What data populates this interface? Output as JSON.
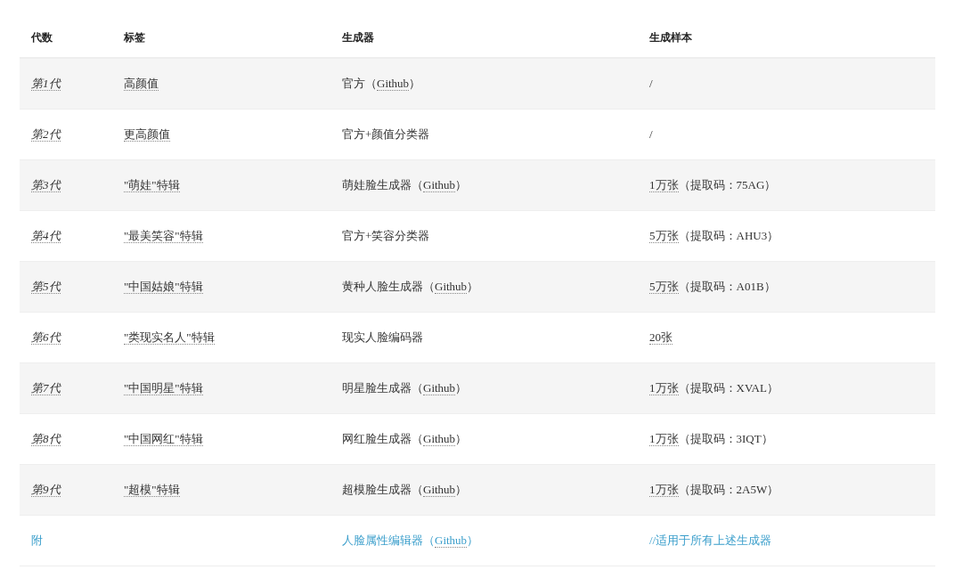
{
  "table": {
    "columns": [
      "代数",
      "标签",
      "生成器",
      "生成样本"
    ],
    "rows": [
      {
        "kind": "normal",
        "cells": [
          [
            {
              "text": "第1代",
              "link": true
            }
          ],
          [
            {
              "text": "高颜值",
              "link": true
            }
          ],
          [
            {
              "text": "官方（",
              "link": false
            },
            {
              "text": "Github",
              "link": true
            },
            {
              "text": "）",
              "link": false
            }
          ],
          [
            {
              "text": "/",
              "link": false
            }
          ]
        ]
      },
      {
        "kind": "normal",
        "cells": [
          [
            {
              "text": "第2代",
              "link": true
            }
          ],
          [
            {
              "text": "更高颜值",
              "link": true
            }
          ],
          [
            {
              "text": "官方+颜值分类器",
              "link": false
            }
          ],
          [
            {
              "text": "/",
              "link": false
            }
          ]
        ]
      },
      {
        "kind": "normal",
        "cells": [
          [
            {
              "text": "第3代",
              "link": true
            }
          ],
          [
            {
              "text": "\"萌娃\"特辑",
              "link": true
            }
          ],
          [
            {
              "text": "萌娃脸生成器（",
              "link": false
            },
            {
              "text": "Github",
              "link": true
            },
            {
              "text": "）",
              "link": false
            }
          ],
          [
            {
              "text": "1万张",
              "link": true
            },
            {
              "text": "（提取码：75AG）",
              "link": false
            }
          ]
        ]
      },
      {
        "kind": "normal",
        "cells": [
          [
            {
              "text": "第4代",
              "link": true
            }
          ],
          [
            {
              "text": "\"最美笑容\"特辑",
              "link": true
            }
          ],
          [
            {
              "text": "官方+笑容分类器",
              "link": false
            }
          ],
          [
            {
              "text": "5万张",
              "link": true
            },
            {
              "text": "（提取码：AHU3）",
              "link": false
            }
          ]
        ]
      },
      {
        "kind": "normal",
        "cells": [
          [
            {
              "text": "第5代",
              "link": true
            }
          ],
          [
            {
              "text": "\"中国姑娘\"特辑",
              "link": true
            }
          ],
          [
            {
              "text": "黄种人脸生成器（",
              "link": false
            },
            {
              "text": "Github",
              "link": true
            },
            {
              "text": "）",
              "link": false
            }
          ],
          [
            {
              "text": "5万张",
              "link": true
            },
            {
              "text": "（提取码：A01B）",
              "link": false
            }
          ]
        ]
      },
      {
        "kind": "normal",
        "cells": [
          [
            {
              "text": "第6代",
              "link": true
            }
          ],
          [
            {
              "text": "\"类现实名人\"特辑",
              "link": true
            }
          ],
          [
            {
              "text": "现实人脸编码器",
              "link": false
            }
          ],
          [
            {
              "text": "20张",
              "link": true
            }
          ]
        ]
      },
      {
        "kind": "normal",
        "cells": [
          [
            {
              "text": "第7代",
              "link": true
            }
          ],
          [
            {
              "text": "\"中国明星\"特辑",
              "link": true
            }
          ],
          [
            {
              "text": "明星脸生成器（",
              "link": false
            },
            {
              "text": "Github",
              "link": true
            },
            {
              "text": "）",
              "link": false
            }
          ],
          [
            {
              "text": "1万张",
              "link": true
            },
            {
              "text": "（提取码：XVAL）",
              "link": false
            }
          ]
        ]
      },
      {
        "kind": "normal",
        "cells": [
          [
            {
              "text": "第8代",
              "link": true
            }
          ],
          [
            {
              "text": "\"中国网红\"特辑",
              "link": true
            }
          ],
          [
            {
              "text": "网红脸生成器（",
              "link": false
            },
            {
              "text": "Github",
              "link": true
            },
            {
              "text": "）",
              "link": false
            }
          ],
          [
            {
              "text": "1万张",
              "link": true
            },
            {
              "text": "（提取码：3IQT）",
              "link": false
            }
          ]
        ]
      },
      {
        "kind": "normal",
        "cells": [
          [
            {
              "text": "第9代",
              "link": true
            }
          ],
          [
            {
              "text": "\"超模\"特辑",
              "link": true
            }
          ],
          [
            {
              "text": "超模脸生成器（",
              "link": false
            },
            {
              "text": "Github",
              "link": true
            },
            {
              "text": "）",
              "link": false
            }
          ],
          [
            {
              "text": "1万张",
              "link": true
            },
            {
              "text": "（提取码：2A5W）",
              "link": false
            }
          ]
        ]
      },
      {
        "kind": "appendix",
        "cells": [
          [
            {
              "text": "附",
              "link": false
            }
          ],
          [],
          [
            {
              "text": "人脸属性编辑器（",
              "link": false
            },
            {
              "text": "Github",
              "link": true
            },
            {
              "text": "）",
              "link": false
            }
          ],
          [
            {
              "text": "//适用于所有上述生成器",
              "link": false
            }
          ]
        ]
      }
    ]
  }
}
